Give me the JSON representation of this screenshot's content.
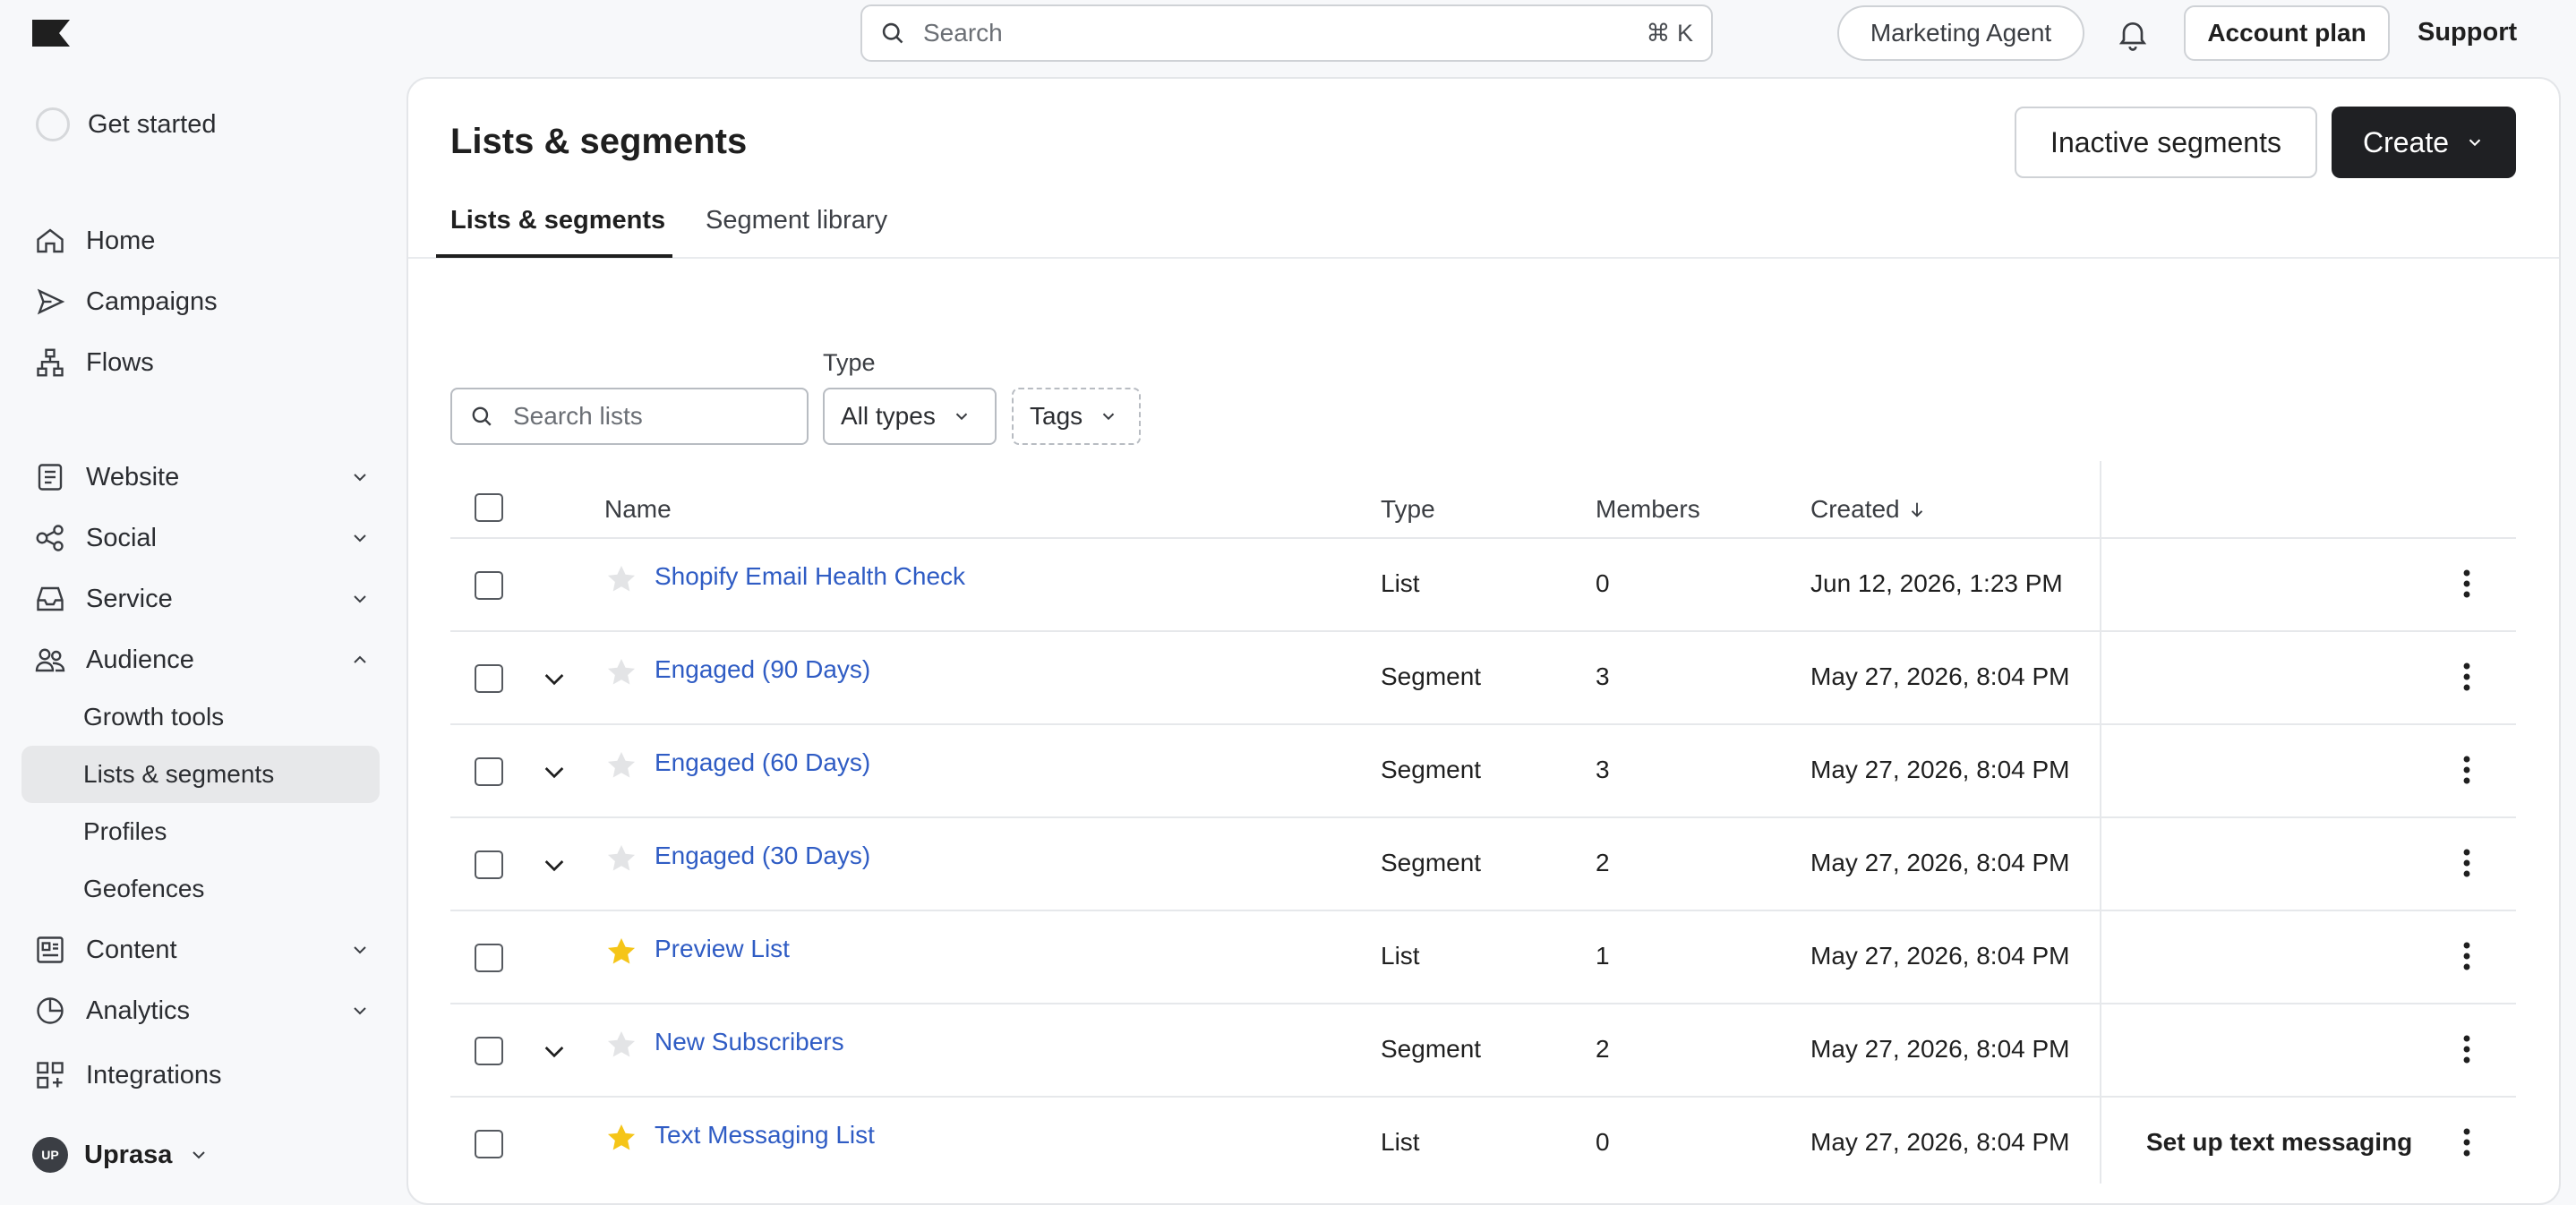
{
  "topbar": {
    "search_placeholder": "Search",
    "search_shortcut": "⌘ K",
    "marketing_agent": "Marketing Agent",
    "account_plan": "Account plan",
    "support": "Support"
  },
  "sidebar": {
    "get_started": "Get started",
    "items": [
      {
        "label": "Home",
        "icon": "home-icon"
      },
      {
        "label": "Campaigns",
        "icon": "send-icon"
      },
      {
        "label": "Flows",
        "icon": "flows-icon"
      },
      {
        "label": "Website",
        "icon": "website-icon"
      },
      {
        "label": "Social",
        "icon": "social-icon"
      },
      {
        "label": "Service",
        "icon": "inbox-icon"
      },
      {
        "label": "Audience",
        "icon": "audience-icon"
      },
      {
        "label": "Content",
        "icon": "content-icon"
      },
      {
        "label": "Analytics",
        "icon": "analytics-icon"
      },
      {
        "label": "Integrations",
        "icon": "integrations-icon"
      }
    ],
    "audience_sub": [
      "Growth tools",
      "Lists & segments",
      "Profiles",
      "Geofences"
    ],
    "user_initials": "UP",
    "user_name": "Uprasa"
  },
  "main": {
    "title": "Lists & segments",
    "inactive_button": "Inactive segments",
    "create_button": "Create",
    "tabs": [
      "Lists & segments",
      "Segment library"
    ],
    "filters": {
      "search_placeholder": "Search lists",
      "type_label": "Type",
      "type_value": "All types",
      "tags_value": "Tags"
    },
    "table": {
      "headers": {
        "name": "Name",
        "type": "Type",
        "members": "Members",
        "created": "Created"
      },
      "rows": [
        {
          "name": "Shopify Email Health Check",
          "type": "List",
          "members": "0",
          "created": "Jun 12, 2026, 1:23 PM",
          "starred": false,
          "expandable": false,
          "action": ""
        },
        {
          "name": "Engaged (90 Days)",
          "type": "Segment",
          "members": "3",
          "created": "May 27, 2026, 8:04 PM",
          "starred": false,
          "expandable": true,
          "action": ""
        },
        {
          "name": "Engaged (60 Days)",
          "type": "Segment",
          "members": "3",
          "created": "May 27, 2026, 8:04 PM",
          "starred": false,
          "expandable": true,
          "action": ""
        },
        {
          "name": "Engaged (30 Days)",
          "type": "Segment",
          "members": "2",
          "created": "May 27, 2026, 8:04 PM",
          "starred": false,
          "expandable": true,
          "action": ""
        },
        {
          "name": "Preview List",
          "type": "List",
          "members": "1",
          "created": "May 27, 2026, 8:04 PM",
          "starred": true,
          "expandable": false,
          "action": ""
        },
        {
          "name": "New Subscribers",
          "type": "Segment",
          "members": "2",
          "created": "May 27, 2026, 8:04 PM",
          "starred": false,
          "expandable": true,
          "action": ""
        },
        {
          "name": "Text Messaging List",
          "type": "List",
          "members": "0",
          "created": "May 27, 2026, 8:04 PM",
          "starred": true,
          "expandable": false,
          "action": "Set up text messaging"
        }
      ]
    },
    "colors": {
      "link": "#2f5cc4",
      "star_active": "#f5c518",
      "star_inactive": "#e3e4e6",
      "primary_button": "#1f2023"
    }
  }
}
